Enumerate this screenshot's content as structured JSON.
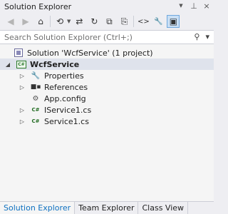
{
  "window": {
    "title": "Solution Explorer",
    "pin_glyph": "⊥",
    "close_glyph": "×",
    "dropdown_glyph": "▼"
  },
  "toolbar": {
    "buttons": [
      {
        "name": "back-icon",
        "glyph": "◀",
        "enabled": false
      },
      {
        "name": "forward-icon",
        "glyph": "▶",
        "enabled": false
      },
      {
        "name": "home-icon",
        "glyph": "⌂",
        "enabled": true
      },
      {
        "name": "pending-changes-icon",
        "glyph": "⟲",
        "enabled": true
      },
      {
        "name": "sync-icon",
        "glyph": "⇄",
        "enabled": true
      },
      {
        "name": "refresh-icon",
        "glyph": "↻",
        "enabled": true
      },
      {
        "name": "collapse-all-icon",
        "glyph": "⧉",
        "enabled": true
      },
      {
        "name": "show-all-files-icon",
        "glyph": "⎘",
        "enabled": true
      },
      {
        "name": "view-code-icon",
        "glyph": "<>",
        "enabled": true
      },
      {
        "name": "properties-icon",
        "glyph": "🔧",
        "enabled": true
      },
      {
        "name": "preview-icon",
        "glyph": "▣",
        "enabled": true,
        "active": true
      }
    ]
  },
  "search": {
    "placeholder": "Search Solution Explorer (Ctrl+;)",
    "value": "",
    "search_glyph": "⚲",
    "dropdown_glyph": "▾"
  },
  "tree": {
    "solution": {
      "label": "Solution 'WcfService' (1 project)"
    },
    "project": {
      "label": "WcfService",
      "badge": "C#",
      "expanded_glyph": "◢"
    },
    "items": [
      {
        "label": "Properties",
        "icon": "properties-icon",
        "expandable": true
      },
      {
        "label": "References",
        "icon": "references-icon",
        "expandable": true
      },
      {
        "label": "App.config",
        "icon": "config-file-icon",
        "expandable": false
      },
      {
        "label": "IService1.cs",
        "icon": "csharp-file-icon",
        "expandable": true
      },
      {
        "label": "Service1.cs",
        "icon": "csharp-file-icon",
        "expandable": true
      }
    ],
    "collapsed_glyph": "▷",
    "cs_badge": "C#"
  },
  "tabs": [
    {
      "label": "Solution Explorer",
      "active": true
    },
    {
      "label": "Team Explorer",
      "active": false
    },
    {
      "label": "Class View",
      "active": false
    }
  ],
  "colors": {
    "accent": "#0e70c0",
    "selection": "#dfe3ec",
    "panel": "#eeeef2"
  }
}
